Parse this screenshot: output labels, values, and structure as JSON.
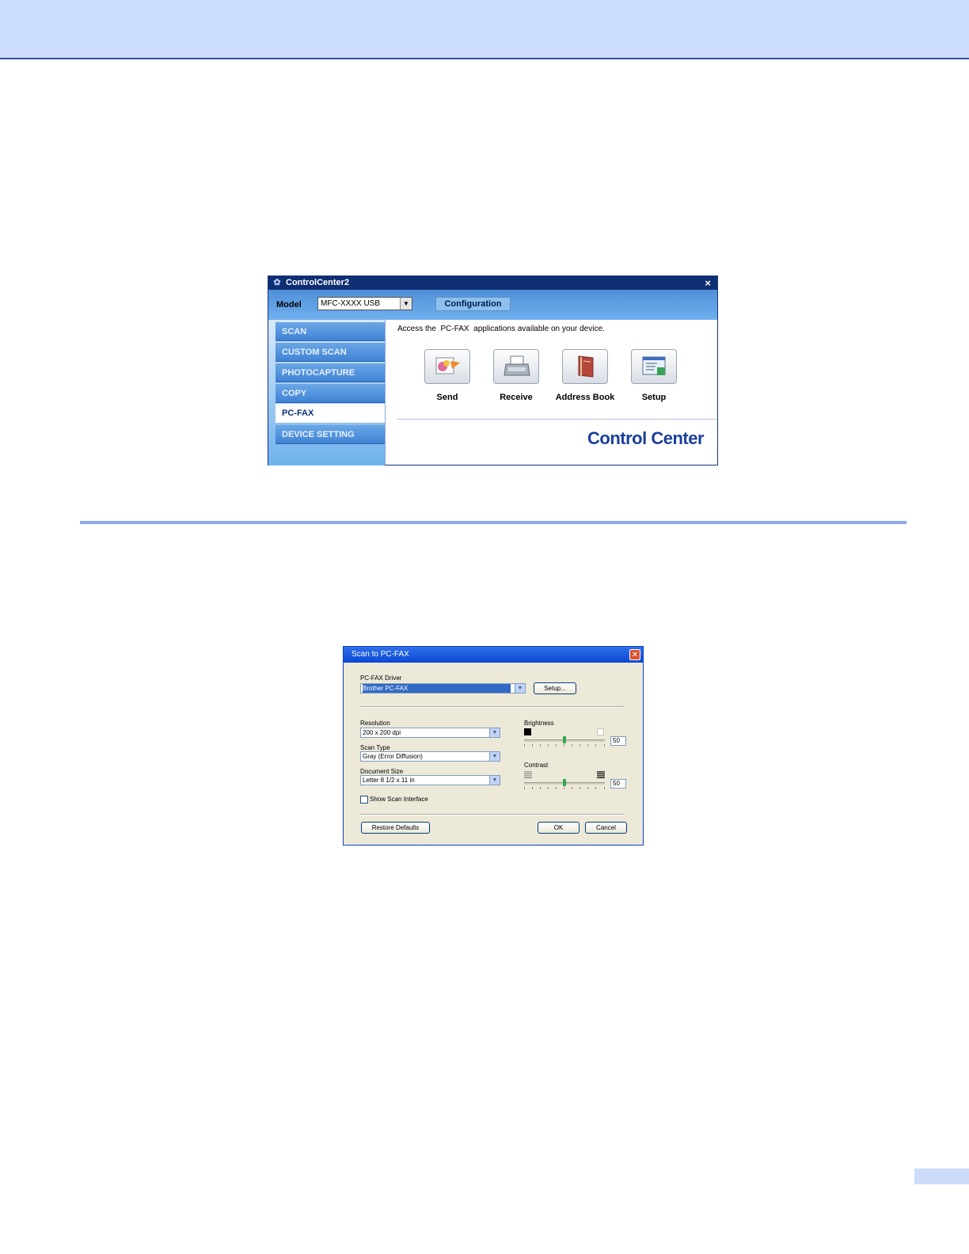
{
  "cc_window": {
    "title": "ControlCenter2",
    "model_label": "Model",
    "model_value": "MFC-XXXX USB",
    "config_button": "Configuration",
    "tabs": [
      "SCAN",
      "CUSTOM SCAN",
      "PHOTOCAPTURE",
      "COPY",
      "PC-FAX",
      "DEVICE SETTING"
    ],
    "active_tab": "PC-FAX",
    "description": "Access the  PC-FAX  applications available on your device.",
    "apps": [
      {
        "label": "Send",
        "icon": "send-icon"
      },
      {
        "label": "Receive",
        "icon": "fax-machine-icon"
      },
      {
        "label": "Address Book",
        "icon": "address-book-icon"
      },
      {
        "label": "Setup",
        "icon": "setup-icon"
      }
    ],
    "logo": "Control Center",
    "close_glyph": "×"
  },
  "scan_dialog": {
    "title": "Scan to PC-FAX",
    "driver_label": "PC-FAX Driver",
    "driver_value": "Brother PC-FAX",
    "setup_button": "Setup...",
    "resolution_label": "Resolution",
    "resolution_value": "200 x 200 dpi",
    "scan_type_label": "Scan Type",
    "scan_type_value": "Gray (Error Diffusion)",
    "document_size_label": "Document Size",
    "document_size_value": "Letter 8 1/2 x 11 in",
    "show_scan_interface_label": "Show Scan Interface",
    "show_scan_interface_checked": false,
    "brightness_label": "Brightness",
    "brightness_value": "50",
    "contrast_label": "Contrast",
    "contrast_value": "50",
    "restore_button": "Restore Defaults",
    "ok_button": "OK",
    "cancel_button": "Cancel"
  }
}
